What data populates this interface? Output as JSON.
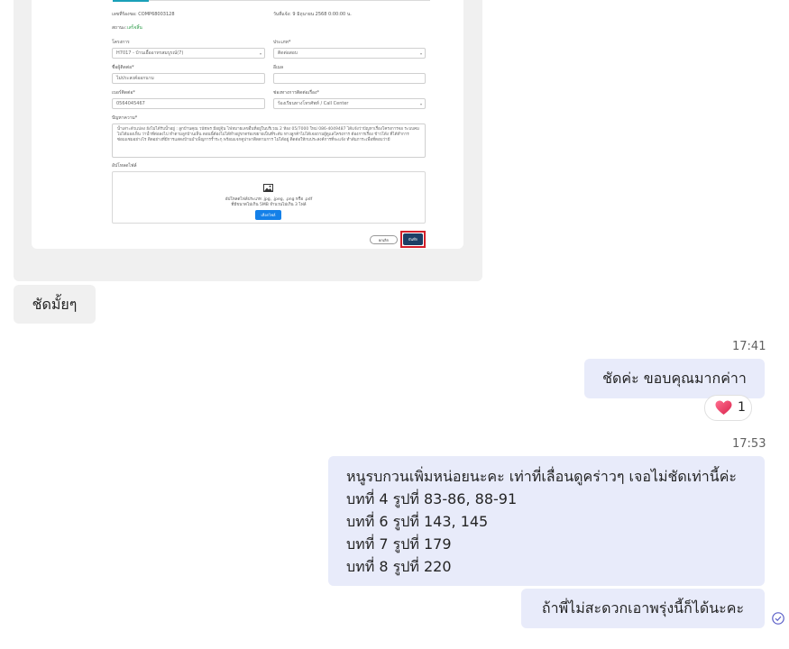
{
  "form": {
    "ref_label": "เลขที่ร้องขอ: COMP68003128",
    "date_label": "วันที่แจ้ง: 9 มิถุนายน 2568 0:00:00 น.",
    "status_label": "สถานะ:",
    "status_value": "เสร็จสิ้น",
    "project_label": "โครงการ",
    "project_value": "H7017 - บ้านเอื้ออาทรสมบูรณ์(7)",
    "type_label": "ประเภท*",
    "type_value": "ติดต่อสอบ",
    "name_label": "ชื่อผู้ติดต่อ*",
    "name_value": "ไม่ประสงค์ออกนาม",
    "email_label": "อีเมล",
    "email_value": "",
    "phone_label": "เบอร์ติดต่อ*",
    "phone_value": "0564045467",
    "channel_label": "ช่องทางการติดต่อเรื่อง*",
    "channel_value": "ร้องเรียนทางโทรศัพท์ / Call Center",
    "problem_label": "ปัญหาความ*",
    "problem_text": "น้ำเสาะตัวแปลง ยังไม่ได้รับน้ำอยู่ : ลูกบ้านคุณ วนัชพร มีอยู่จุ้น ไฟ่หมายเลขอื่นที่อยู่ในบริเวณ 2 ห้อง 05/7000 ใหม่ 086-4049487 ได้แจ้งว่าปัญหาเรื่องโครงการจอ ระบบคม ไม่ได้มองเห็น ว่าน้ำที่ต่อลงไป ทำตามลูกบ้านเห็น ตอนนี้ต้องไม่ได้ทำอยู่ขาดร่องขยายเป็นที่ระดับ ทางลูกค้าไม่ได้เจอถามผู้ดูแลโครงการ ต้องการเรื่อง ข้าวโด้ง ที่ได้ทำการซ่อมแซมอย่างไร ติดอย่างที่มีการแสดงบ้านบำเพ็ญการร้ำระกุ พร้อมแจกคูปาพาติดตามการ ไม่ได้อยู่ ติดต่อให้กบประสงค์การที่จะแจ้ง ทำสัมภาระเพื่อที่ตอบว่ามี",
    "attach_label": "อัปโหลดไฟล์",
    "upload_hint_1": "อัปโหลดไฟล์ประเภท .jpg, .jpeg, .png หรือ .pdf",
    "upload_hint_2": "ที่มีขนาดไม่เกิน 5MB จำนวนไม่เกิน 3 ไฟล์",
    "pick_file": "เลือกไฟล์",
    "cancel": "ยกเลิก",
    "save": "บันทึก"
  },
  "chat": {
    "incoming_message": "ชัดมั้ยๆ",
    "time_1": "17:41",
    "message_1": "ชัดค่ะ ขอบคุณมากค่าา",
    "reaction_count": "1",
    "time_2": "17:53",
    "message_2_lines": [
      "หนูรบกวนเพิ่มหน่อยนะคะ เท่าที่เลื่อนดูคร่าวๆ เจอไม่ชัดเท่านี้ค่ะ",
      "บทที่ 4 รูปที่ 83-86, 88-91",
      "บทที่ 6 รูปที่ 143, 145",
      "บทที่ 7 รูปที่ 179",
      "บทที่ 8 รูปที่ 220"
    ],
    "message_3": "ถ้าพี่ไม่สะดวกเอาพรุ่งนี้ก็ได้นะคะ"
  },
  "colors": {
    "outgoing_bubble": "#e8ebfa",
    "incoming_bubble": "#f0f0f0",
    "save_button": "#1c3f66",
    "highlight_ring": "#d3202a",
    "pick_button": "#1480e8",
    "status_green": "#2e9c4a"
  },
  "icons": [
    "image-icon",
    "heart-reaction-icon",
    "seen-check-icon"
  ]
}
